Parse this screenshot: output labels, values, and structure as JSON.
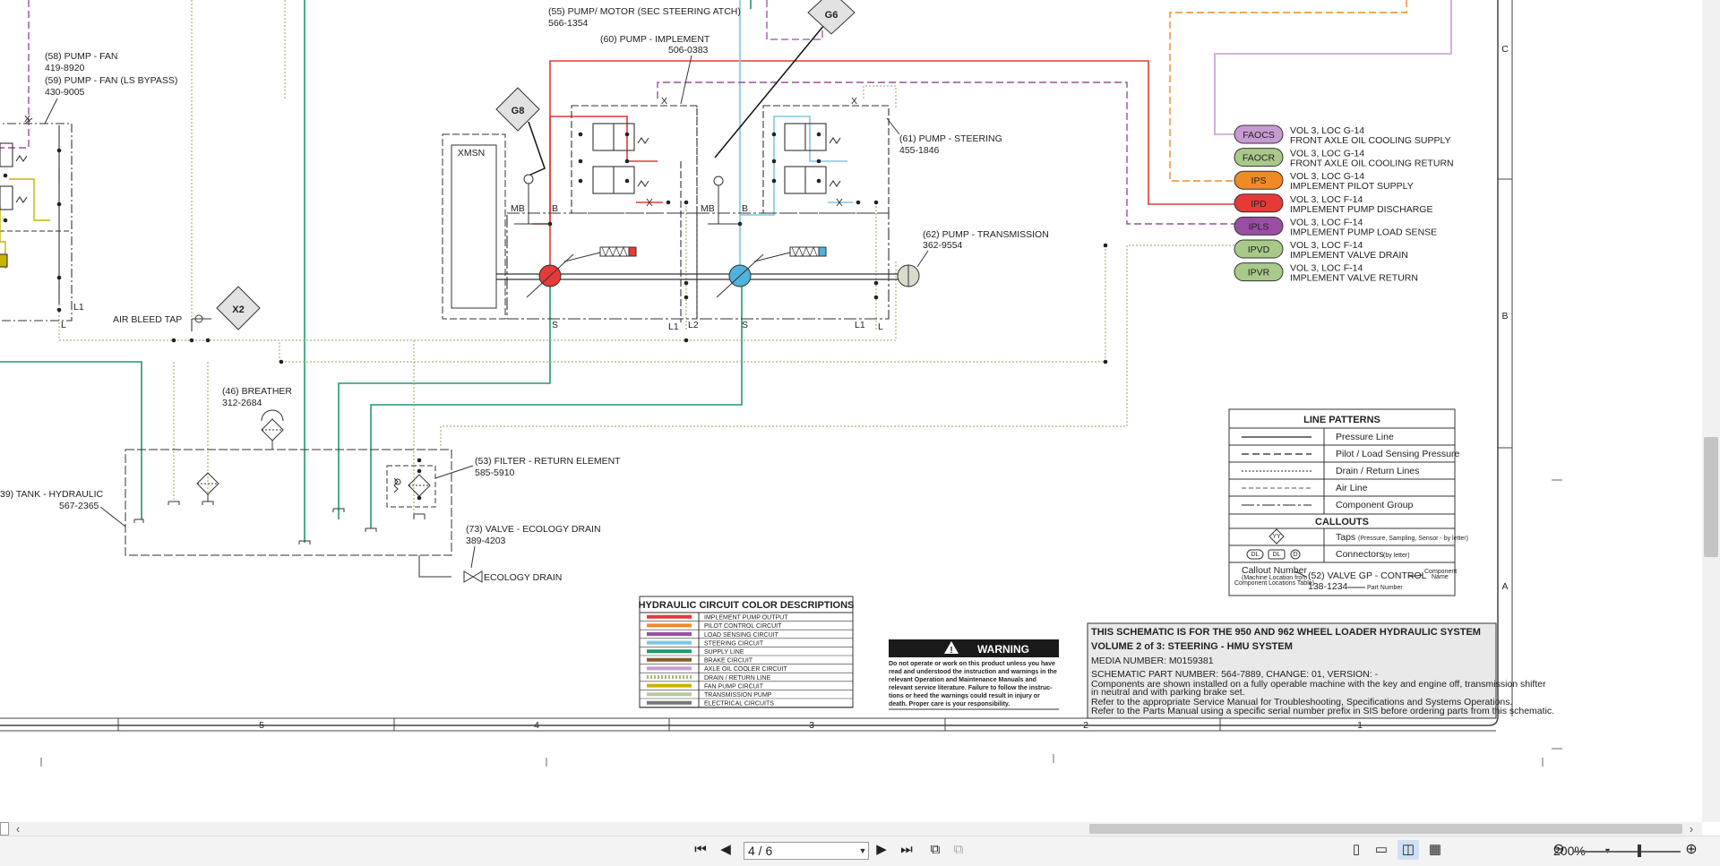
{
  "schematic": {
    "components": {
      "pump_fan": {
        "name": "(58) PUMP - FAN",
        "part": "419-8920"
      },
      "pump_fan_ls": {
        "name": "(59) PUMP - FAN (LS BYPASS)",
        "part": "430-9005"
      },
      "pump_motor": {
        "name": "(55) PUMP/ MOTOR (SEC STEERING ATCH)",
        "part": "566-1354"
      },
      "pump_implement": {
        "name": "(60) PUMP - IMPLEMENT",
        "part": "506-0383"
      },
      "pump_steering": {
        "name": "(61) PUMP - STEERING",
        "part": "455-1846"
      },
      "pump_transmission": {
        "name": "(62) PUMP - TRANSMISSION",
        "part": "362-9554"
      },
      "breather": {
        "name": "(46) BREATHER",
        "part": "312-2684"
      },
      "filter": {
        "name": "(53) FILTER - RETURN ELEMENT",
        "part": "585-5910"
      },
      "valve_ecology": {
        "name": "(73) VALVE - ECOLOGY DRAIN",
        "part": "389-4203"
      },
      "tank": {
        "name": "39) TANK - HYDRAULIC",
        "part": "567-2365"
      },
      "air_bleed": "AIR BLEED TAP",
      "ecology_drain": "ECOLOGY DRAIN",
      "xmsn": "XMSN"
    },
    "taps": {
      "g8": "G8",
      "g6": "G6",
      "x2": "X2"
    },
    "port_labels": {
      "mb": "MB",
      "b": "B",
      "s": "S",
      "l": "L",
      "l1": "L1",
      "l2": "L2",
      "x": "X"
    },
    "connectors": [
      {
        "code": "FAOCS",
        "loc": "VOL 3, LOC G-14",
        "desc": "FRONT AXLE OIL COOLING SUPPLY",
        "color": "#c79bd2"
      },
      {
        "code": "FAOCR",
        "loc": "VOL 3, LOC G-14",
        "desc": "FRONT AXLE OIL COOLING RETURN",
        "color": "#a9c98a"
      },
      {
        "code": "IPS",
        "loc": "VOL 3, LOC G-14",
        "desc": "IMPLEMENT PILOT SUPPLY",
        "color": "#f08a24"
      },
      {
        "code": "IPD",
        "loc": "VOL 3, LOC F-14",
        "desc": "IMPLEMENT PUMP DISCHARGE",
        "color": "#e63a36"
      },
      {
        "code": "IPLS",
        "loc": "VOL 3, LOC F-14",
        "desc": "IMPLEMENT PUMP LOAD SENSE",
        "color": "#9a4ea3"
      },
      {
        "code": "IPVD",
        "loc": "VOL 3, LOC F-14",
        "desc": "IMPLEMENT VALVE DRAIN",
        "color": "#a9c98a"
      },
      {
        "code": "IPVR",
        "loc": "VOL 3, LOC F-14",
        "desc": "IMPLEMENT VALVE RETURN",
        "color": "#a9c98a"
      }
    ],
    "line_patterns": {
      "title": "LINE PATTERNS",
      "rows": [
        "Pressure Line",
        "Pilot / Load Sensing Pressure",
        "Drain / Return Lines",
        "Air Line",
        "Component Group"
      ],
      "callouts_title": "CALLOUTS",
      "taps_label": "Taps",
      "taps_note": "(Pressure, Sampling, Sensor - by letter)",
      "taps_symbol": "YY",
      "connectors_label": "Connectors",
      "connectors_note": "(by letter)",
      "connector_symbols": [
        "DL",
        "DL",
        "D"
      ],
      "callout_number": "Callout Number",
      "callout_number_note1": "(Machine Location from",
      "callout_number_note2": "Component Locations Table)",
      "callout_example": "(52) VALVE GP - CONTROL",
      "callout_part": "138-1234",
      "component_name_note1": "Component",
      "component_name_note2": "Name",
      "part_number_note": "Part Number"
    },
    "color_table": {
      "title": "HYDRAULIC CIRCUIT COLOR DESCRIPTIONS",
      "rows": [
        {
          "label": "IMPLEMENT PUMP OUTPUT",
          "color": "#e63a36"
        },
        {
          "label": "PILOT CONTROL CIRCUIT",
          "color": "#f08a24"
        },
        {
          "label": "LOAD SENSING CIRCUIT",
          "color": "#9a4ea3"
        },
        {
          "label": "STEERING CIRCUIT",
          "color": "#7ec8e3"
        },
        {
          "label": "SUPPLY LINE",
          "color": "#1f9a6e"
        },
        {
          "label": "BRAKE CIRCUIT",
          "color": "#8a5a2b"
        },
        {
          "label": "AXLE OIL COOLER CIRCUIT",
          "color": "#c79bd2"
        },
        {
          "label": "DRAIN / RETURN LINE",
          "color": "#a9b57a"
        },
        {
          "label": "FAN PUMP CIRCUIT",
          "color": "#c8b400"
        },
        {
          "label": "TRANSMISSION PUMP",
          "color": "#b9c9a0"
        },
        {
          "label": "ELECTRICAL CIRCUITS",
          "color": "#777777"
        }
      ]
    },
    "warning": {
      "title": "WARNING",
      "lines": [
        "Do not operate or work on this product unless you have",
        "read and understood the instruction and warnings in the",
        "relevant Operation and Maintenance Manuals and",
        "relevant service literature. Failure to follow the instruc-",
        "tions or heed the warnings could result in injury or",
        "death. Proper care is your responsibility."
      ]
    },
    "title_block": {
      "line1": "THIS SCHEMATIC IS FOR THE 950 AND 962 WHEEL LOADER HYDRAULIC SYSTEM",
      "line2": "VOLUME 2 of 3: STEERING - HMU SYSTEM",
      "line3": "MEDIA NUMBER: M0159381",
      "line4": "SCHEMATIC PART NUMBER: 564-7889, CHANGE: 01, VERSION: -",
      "note1": "Components are shown installed on a fully operable machine with the key and engine off, transmission shifter",
      "note2": "in neutral and with parking brake set.",
      "note3": "Refer to the appropriate Service Manual for Troubleshooting, Specifications and Systems Operations.",
      "note4": "Refer to the Parts Manual using a specific serial number prefix in SIS before ordering parts from this schematic."
    },
    "grid_columns": [
      "5",
      "4",
      "3",
      "2",
      "1"
    ],
    "grid_rows": [
      "C",
      "B",
      "A"
    ]
  },
  "viewer": {
    "page_indicator": "4 / 6",
    "zoom": "200%",
    "colors": {
      "accent": "#2a6ebb",
      "toolbar_bg": "#f3f3f3"
    }
  }
}
